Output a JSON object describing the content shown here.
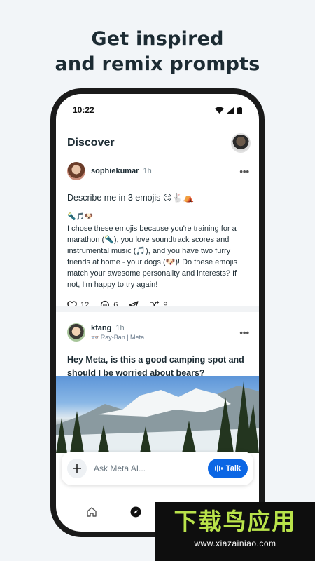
{
  "headline": {
    "line1": "Get inspired",
    "line2": "and remix prompts"
  },
  "status_bar": {
    "time": "10:22"
  },
  "app": {
    "title": "Discover"
  },
  "posts": [
    {
      "author": "sophiekumar",
      "time": "1h",
      "prompt": "Describe me in 3 emojis 😏🐇⛺",
      "emoji_line": "🔦🎵🐶",
      "body": "I chose these emojis because you're training for a marathon (🔦), you love soundtrack scores and instrumental music (🎵), and you have two furry friends at home - your dogs (🐶)! Do these emojis match your awesome personality and interests? If not, I'm happy to try again!",
      "likes": "12",
      "comments": "6",
      "remixes": "9"
    },
    {
      "author": "kfang",
      "time": "1h",
      "device": "👓 Ray-Ban | Meta",
      "prompt": "Hey Meta, is this a good camping spot and should I be worried about bears?"
    }
  ],
  "composer": {
    "placeholder": "Ask Meta AI...",
    "talk_label": "Talk"
  },
  "watermark": {
    "title": "下载鸟应用",
    "url": "www.xiazainiao.com"
  },
  "colors": {
    "accent": "#0b66e4",
    "background": "#f2f5f8",
    "watermark_green": "#b9e34a"
  },
  "icons": {
    "signal": "signal-icon",
    "wifi": "wifi-icon",
    "battery": "battery-icon",
    "heart": "heart-icon",
    "comment": "comment-icon",
    "share": "share-icon",
    "remix": "shuffle-icon",
    "plus": "plus-icon",
    "waveform": "waveform-icon",
    "home": "home-icon",
    "discover": "compass-icon",
    "library": "library-icon"
  }
}
